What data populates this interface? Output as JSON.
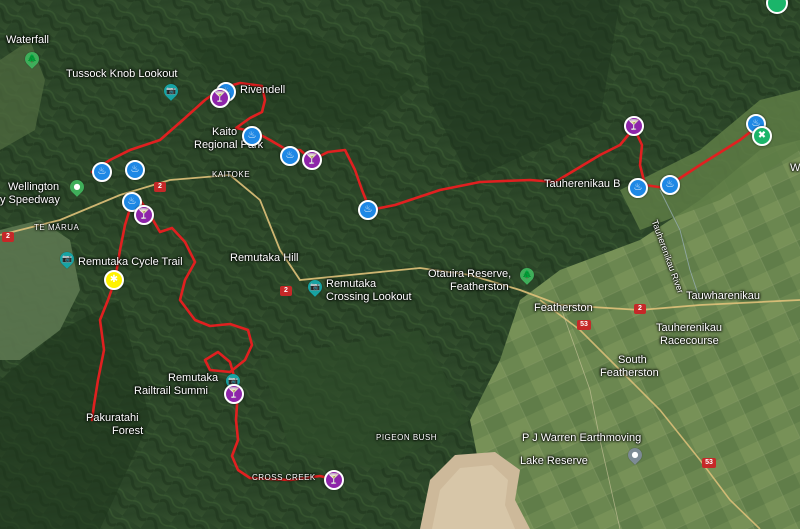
{
  "map": {
    "colors": {
      "route": "#e02020",
      "marker_blue": "#1e88e5",
      "marker_purple": "#8e24aa",
      "marker_yellow": "#fff200",
      "forest_dark": "#233c22",
      "forest_light": "#3e6233",
      "farmland": "#6f8a55",
      "lake_water": "#cdb99a"
    },
    "place_labels": {
      "waterfall": "Waterfall",
      "tussock_knob_lookout": "Tussock Knob Lookout",
      "rivendell": "Rivendell",
      "kaitoke": "Kaito",
      "kaitoke_regional_park": "Regional Park",
      "wellington": "Wellington",
      "speedway": "y Speedway",
      "te_marua": "TE MĀRUA",
      "kaitoke_road": "KAITOKE",
      "remutaka_cycle_trail": "Remutaka Cycle Trail",
      "remutaka_hill": "Remutaka Hill",
      "remutaka_crossing_lookout_1": "Remutaka",
      "remutaka_crossing_lookout_2": "Crossing Lookout",
      "otaraua_reserve_1": "Otauira Reserve,",
      "otaraua_reserve_2": "Featherston",
      "tauherenikau_bridge": "Tauherenikau B",
      "tauherenikau_river": "Tauherenikau River",
      "featherston": "Featherston",
      "tauwharenikau": "Tauwharenikau",
      "tauherenikau_racecourse_1": "Tauherenikau",
      "tauherenikau_racecourse_2": "Racecourse",
      "south_featherston_1": "South",
      "south_featherston_2": "Featherston",
      "remutaka_railtrail_summit_1": "Remutaka",
      "remutaka_railtrail_summit_2": "Railtrail Summi",
      "pakuratahi_forest_1": "Pakuratahi",
      "pakuratahi_forest_2": "Forest",
      "pigeon_bush": "PIGEON BUSH",
      "cross_creek": "CROSS CREEK",
      "pj_warren": "P J Warren Earthmoving",
      "lake_reserve": "Lake Reserve",
      "edge_w": "W"
    },
    "road_shields": {
      "sh2_a": "2",
      "sh2_b": "2",
      "sh2_c": "2",
      "sh2_d": "2",
      "sh53_a": "53",
      "sh53_b": "53"
    },
    "markers": {
      "blue_symbol": "♨",
      "purple_symbol": "🍸",
      "yellow_symbol": "✱",
      "green_symbol": "✖"
    },
    "poi_icons": {
      "camera": "📷",
      "tree": "🌲",
      "pin": "●"
    }
  }
}
